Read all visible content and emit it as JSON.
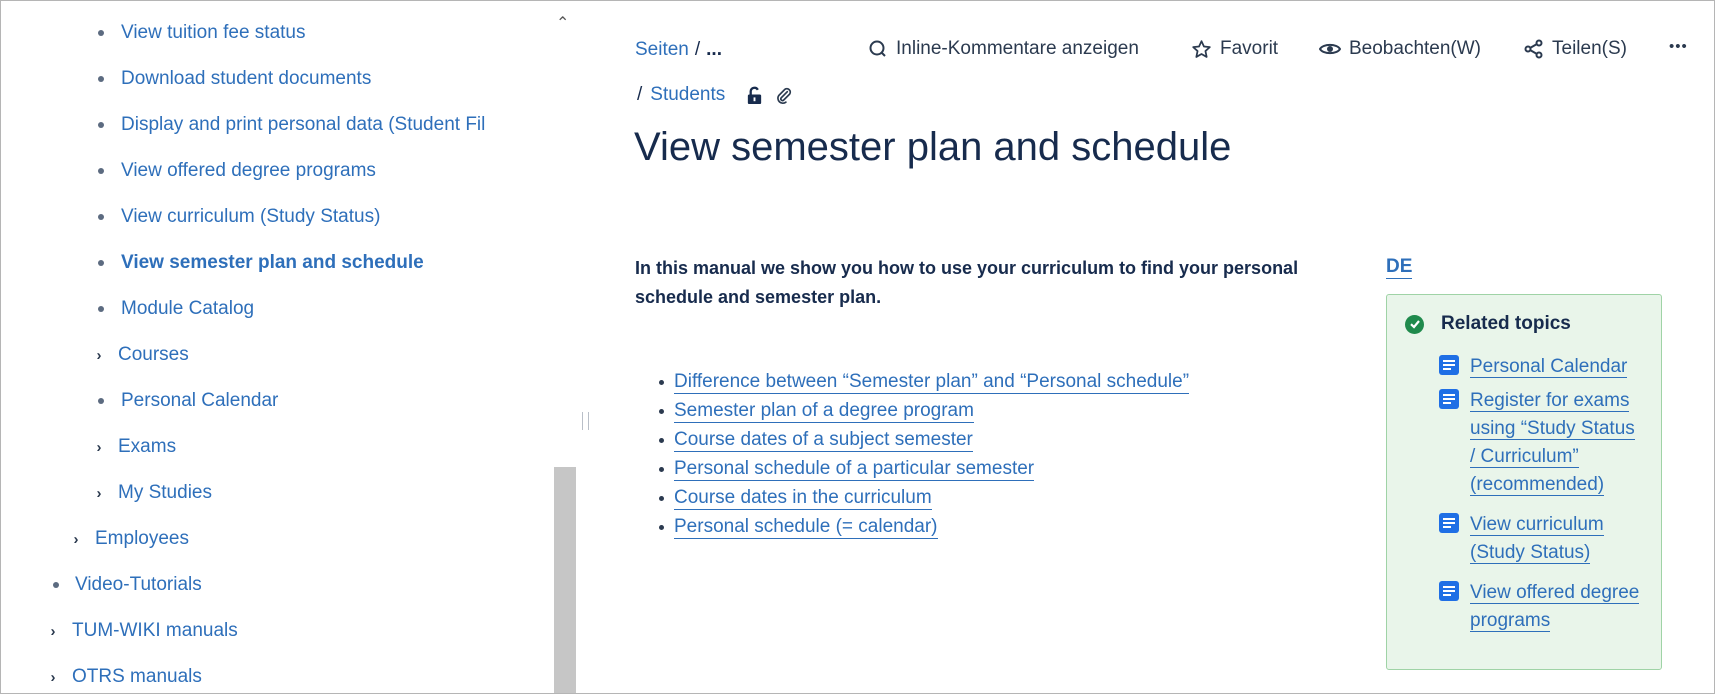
{
  "sidebar": {
    "items": [
      {
        "label": "View tuition fee status",
        "marker": "bullet"
      },
      {
        "label": "Download student documents",
        "marker": "bullet"
      },
      {
        "label": "Display and print personal data (Student Fil",
        "marker": "bullet"
      },
      {
        "label": "View offered degree programs",
        "marker": "bullet"
      },
      {
        "label": "View curriculum (Study Status)",
        "marker": "bullet"
      },
      {
        "label": "View semester plan and schedule",
        "marker": "bullet",
        "active": true
      },
      {
        "label": "Module Catalog",
        "marker": "bullet"
      },
      {
        "label": "Courses",
        "marker": "chevron"
      },
      {
        "label": "Personal Calendar",
        "marker": "bullet"
      },
      {
        "label": "Exams",
        "marker": "chevron"
      },
      {
        "label": "My Studies",
        "marker": "chevron"
      },
      {
        "label": "Employees",
        "marker": "chevron"
      },
      {
        "label": "Video-Tutorials",
        "marker": "bullet"
      },
      {
        "label": "TUM-WIKI manuals",
        "marker": "chevron"
      },
      {
        "label": "OTRS manuals",
        "marker": "chevron"
      }
    ]
  },
  "breadcrumb": {
    "root": "Seiten",
    "separator": "/",
    "ellipsis": "...",
    "parent": "Students"
  },
  "toolbar": {
    "inline_comments": "Inline-Kommentare anzeigen",
    "favorite": "Favorit",
    "watch": "Beobachten(W)",
    "share": "Teilen(S)",
    "more": "•••"
  },
  "page": {
    "title": "View semester plan and schedule",
    "intro": "In this manual we show you how to use your curriculum to find your personal schedule and semester plan.",
    "toc": [
      "Difference between “Semester plan” and  “Personal schedule”",
      "Semester plan of a degree program",
      "Course dates of a subject semester",
      "Personal schedule of a particular semester ",
      "Course dates in the curriculum",
      "Personal schedule (= calendar)"
    ],
    "language_link": "DE"
  },
  "related": {
    "title": "Related topics",
    "links": [
      [
        "Personal Calendar"
      ],
      [
        "Register for exams",
        "using “Study Status",
        "/ Curriculum”",
        "(recommended)"
      ],
      [
        "View curriculum",
        "(Study Status)"
      ],
      [
        "View offered degree",
        "programs"
      ]
    ]
  },
  "colors": {
    "link": "#2e6fba",
    "text": "#172b4d",
    "panel_bg": "#e9f5ea",
    "panel_border": "#9fd3a6",
    "check": "#1f8a4c",
    "doc_icon": "#1f6fe5"
  }
}
